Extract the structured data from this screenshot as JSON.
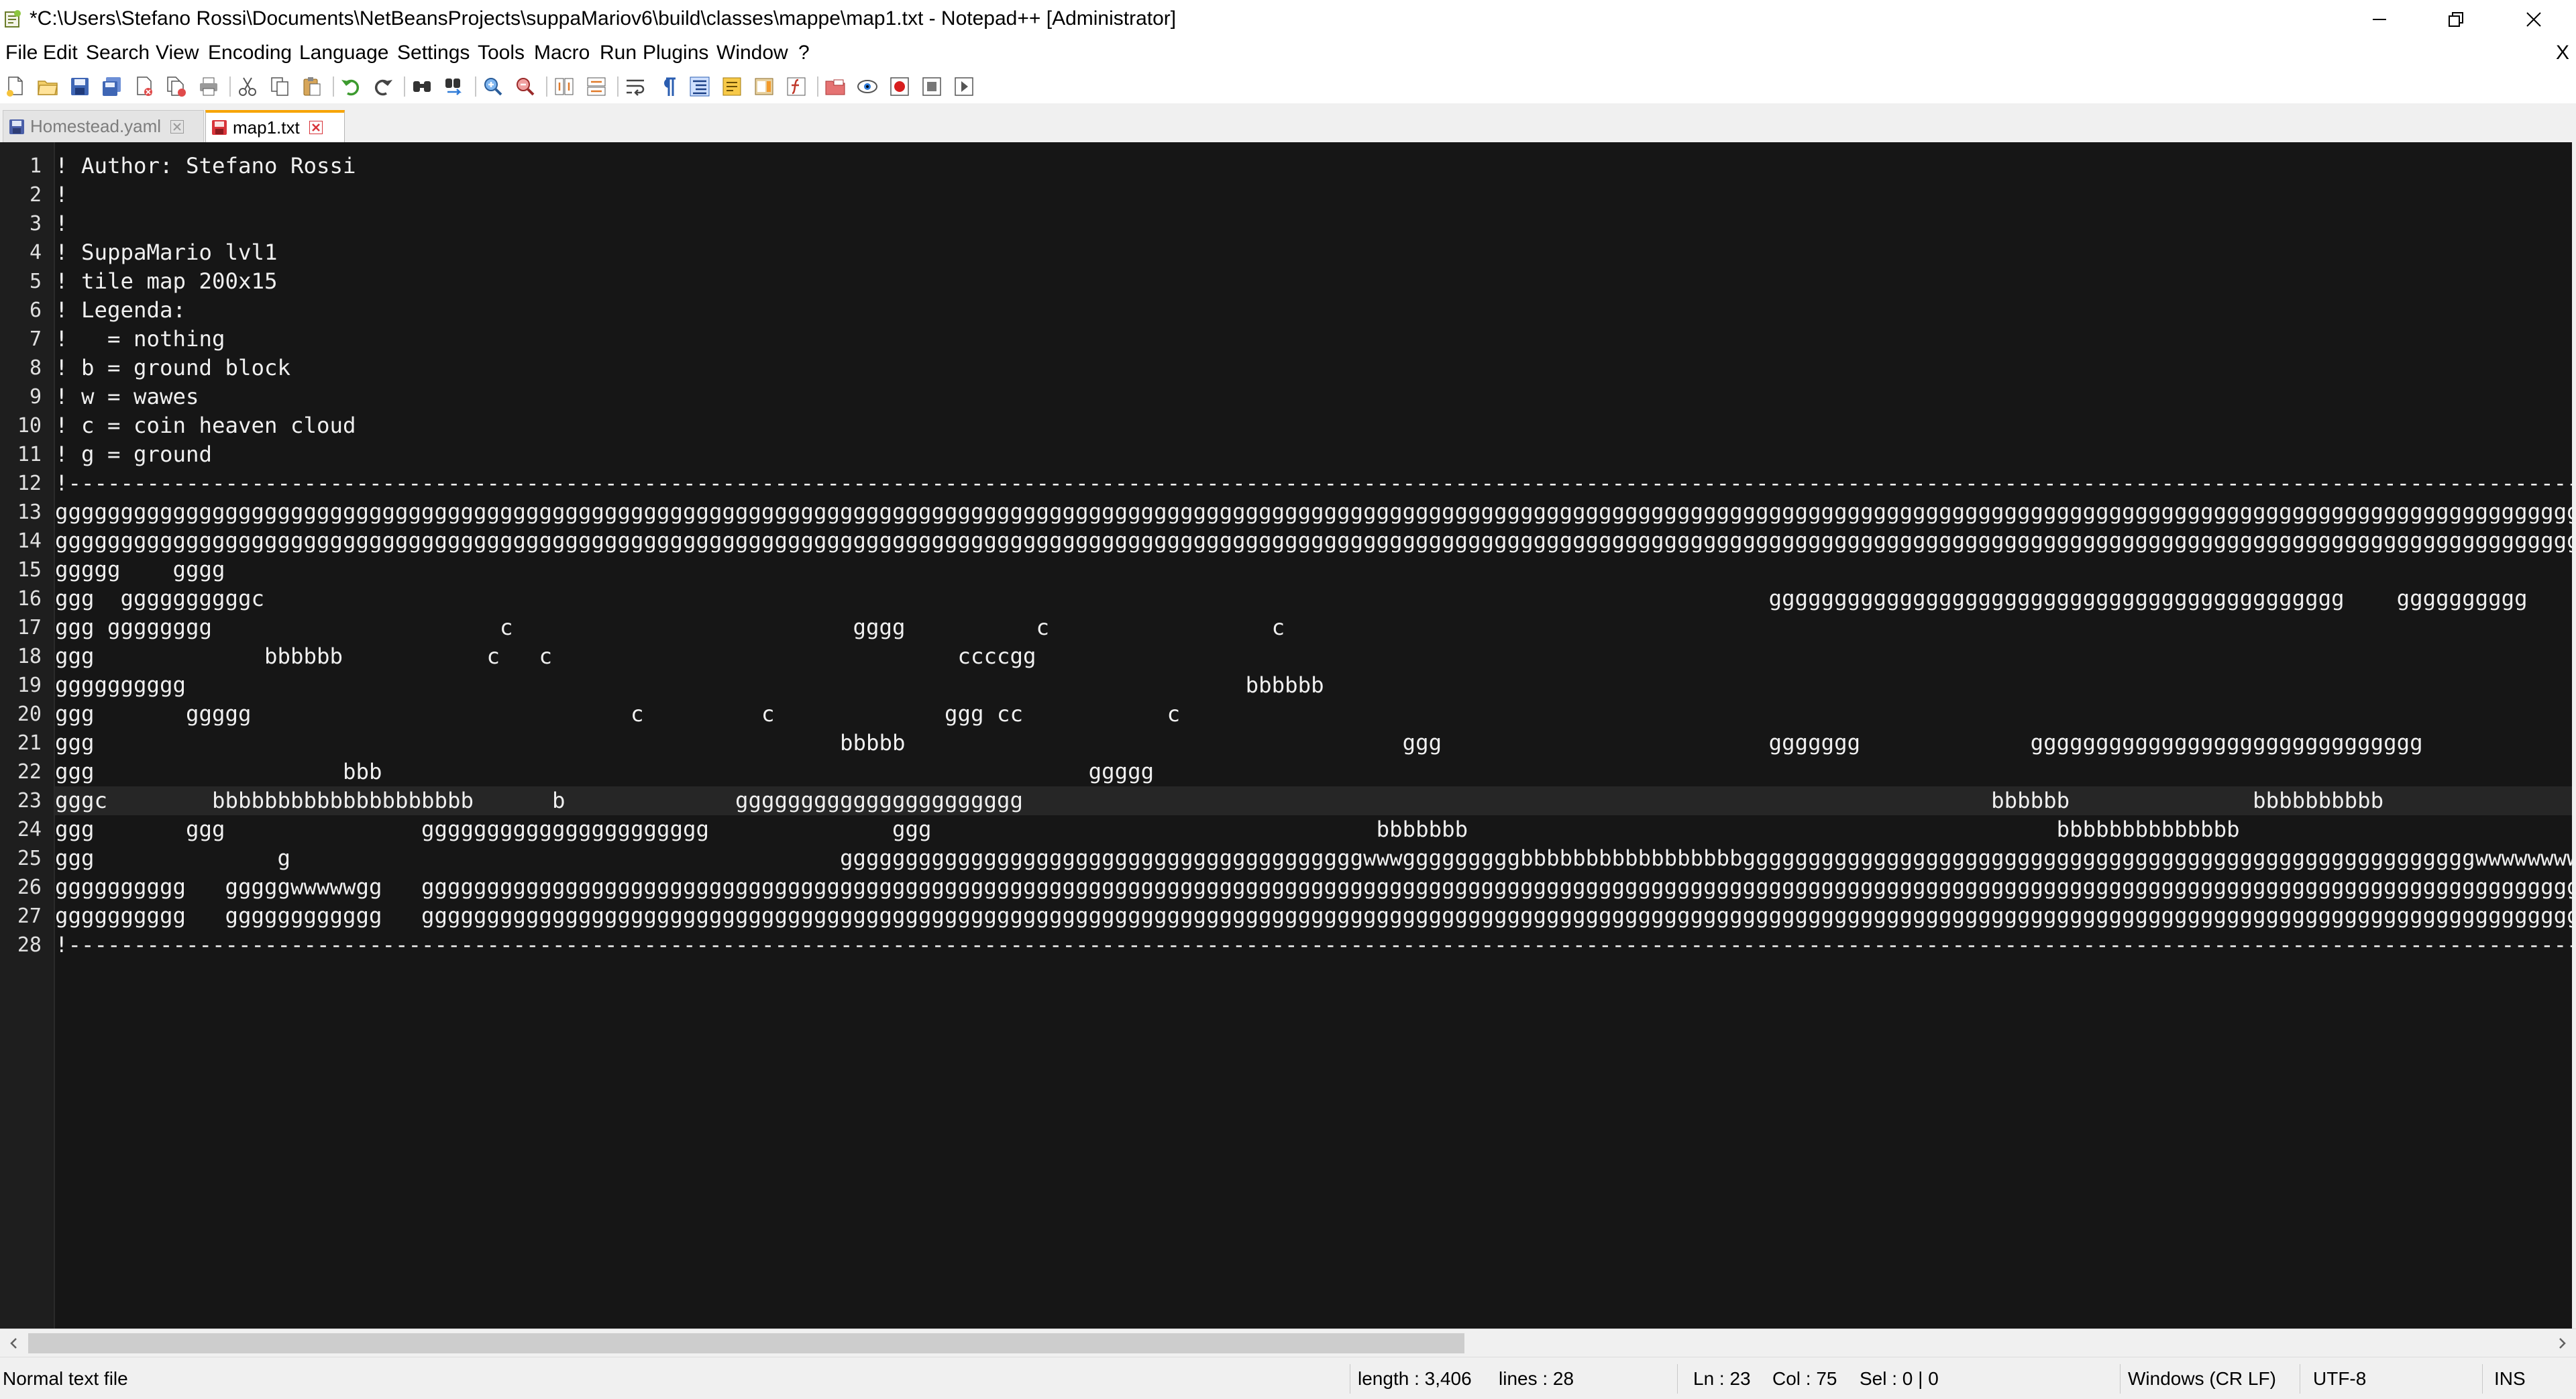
{
  "window": {
    "title": "*C:\\Users\\Stefano Rossi\\Documents\\NetBeansProjects\\suppaMariov6\\build\\classes\\mappe\\map1.txt - Notepad++ [Administrator]"
  },
  "menu": {
    "items": [
      "File",
      "Edit",
      "Search",
      "View",
      "Encoding",
      "Language",
      "Settings",
      "Tools",
      "Macro",
      "Run",
      "Plugins",
      "Window",
      "?"
    ],
    "close_doc": "X"
  },
  "toolbar": {
    "icons": [
      "new-file-icon",
      "open-file-icon",
      "save-icon",
      "save-all-icon",
      "close-icon",
      "close-all-icon",
      "print-icon",
      "cut-icon",
      "copy-icon",
      "paste-icon",
      "undo-icon",
      "redo-icon",
      "find-icon",
      "replace-icon",
      "zoom-in-icon",
      "zoom-out-icon",
      "sync-vertical-icon",
      "sync-horizontal-icon",
      "word-wrap-icon",
      "show-all-chars-icon",
      "indent-guide-icon",
      "user-language-icon",
      "document-map-icon",
      "function-list-icon",
      "folder-workspace-icon",
      "monitoring-icon",
      "record-macro-icon",
      "stop-record-icon",
      "play-macro-icon",
      "run-macro-multiple-icon",
      "save-macro-icon"
    ]
  },
  "tabs": [
    {
      "label": "Homestead.yaml",
      "active": false
    },
    {
      "label": "map1.txt",
      "active": true
    }
  ],
  "editor": {
    "current_line": 23,
    "lines": [
      "! Author: Stefano Rossi",
      "!",
      "!",
      "! SuppaMario lvl1",
      "! tile map 200x15",
      "! Legenda:",
      "!   = nothing",
      "! b = ground block",
      "! w = wawes",
      "! c = coin heaven cloud",
      "! g = ground",
      "!--------------------------------------------------------------------------------------------------------------------------------------------------------------------------------------------------------",
      "gggggggggggggggggggggggggggggggggggggggggggggggggggggggggggggggggggggggggggggggggggggggggggggggggggggggggggggggggggggggggggggggggggggggggggggggggggggggggggggggggggggggggggggggggggggggggggggggggggggggg",
      "gggggggggggggggggggggggggggggggggggggggggggggggggggggggggggggggggggggggggggggggggggggggggggggggggggggggggggggggggggggggggggggggggggggggggggggggggggggggggggggggggggggggggggggggggggggggggggggggggggggggg",
      "ggggg    gggg",
      "ggg  ggggggggggc                                                                                                                   gggggggggggggggggggggggggggggggggggggggggggg    gggggggggg",
      "ggg gggggggg                      c                          gggg          c                 c",
      "ggg             bbbbbb           c   c                               ccccgg",
      "gggggggggg                                                                                 bbbbbb",
      "ggg       ggggg                             c         c             ggg cc           c",
      "ggg                                                         bbbbb                                      ggg                         ggggggg             gggggggggggggggggggggggggggggg",
      "ggg                   bbb                                                      ggggg",
      "gggc        bbbbbbbbbbbbbbbbbbbb      b             gggggggggggggggggggggg                                                                          bbbbbb              bbbbbbbbbb",
      "ggg       ggg               gggggggggggggggggggggg              ggg                                  bbbbbbb                                             bbbbbbbbbbbbbb",
      "ggg              g                                          ggggggggggggggggggggggggggggggggggggggggwwwgggggggggbbbbbbbbbbbbbbbbbggggggggggggggggggggggggggggggggggggggggggggggggggggggggwwwwwwwwwwwwwww",
      "gggggggggg   gggggwwwwwgg   ggggggggggggggggggggggggggggggggggggggggggggggggggggggggggggggggggggggggggggggggggggggggggggggggggggggggggggggggggggggggggggggggggggggggggggggggggggggggggggggggggggggggwwwwwwwww",
      "gggggggggg   gggggggggggg   gggggggggggggggggggggggggggggggggggggggggggggggggggggggggggggggggggggggggggggggggggggggggggggggggggggggggggggggggggggggggggggggggggggggggggggggggggggggggggggggggggggggggggg",
      "!--------------------------------------------------------------------------------------------------------------------------------------------------------------------------------------------------------"
    ]
  },
  "scrollbar": {
    "horizontal_thumb_fraction": 0.57
  },
  "status": {
    "file_type": "Normal text file",
    "length": "length : 3,406",
    "lines": "lines : 28",
    "ln": "Ln : 23",
    "col": "Col : 75",
    "sel": "Sel : 0 | 0",
    "eol": "Windows (CR LF)",
    "encoding": "UTF-8",
    "mode": "INS"
  },
  "colors": {
    "editor_bg": "#161616",
    "editor_fg": "#f0f0f0",
    "active_tab_accent": "#f7a400",
    "current_line_bg": "#262626"
  }
}
